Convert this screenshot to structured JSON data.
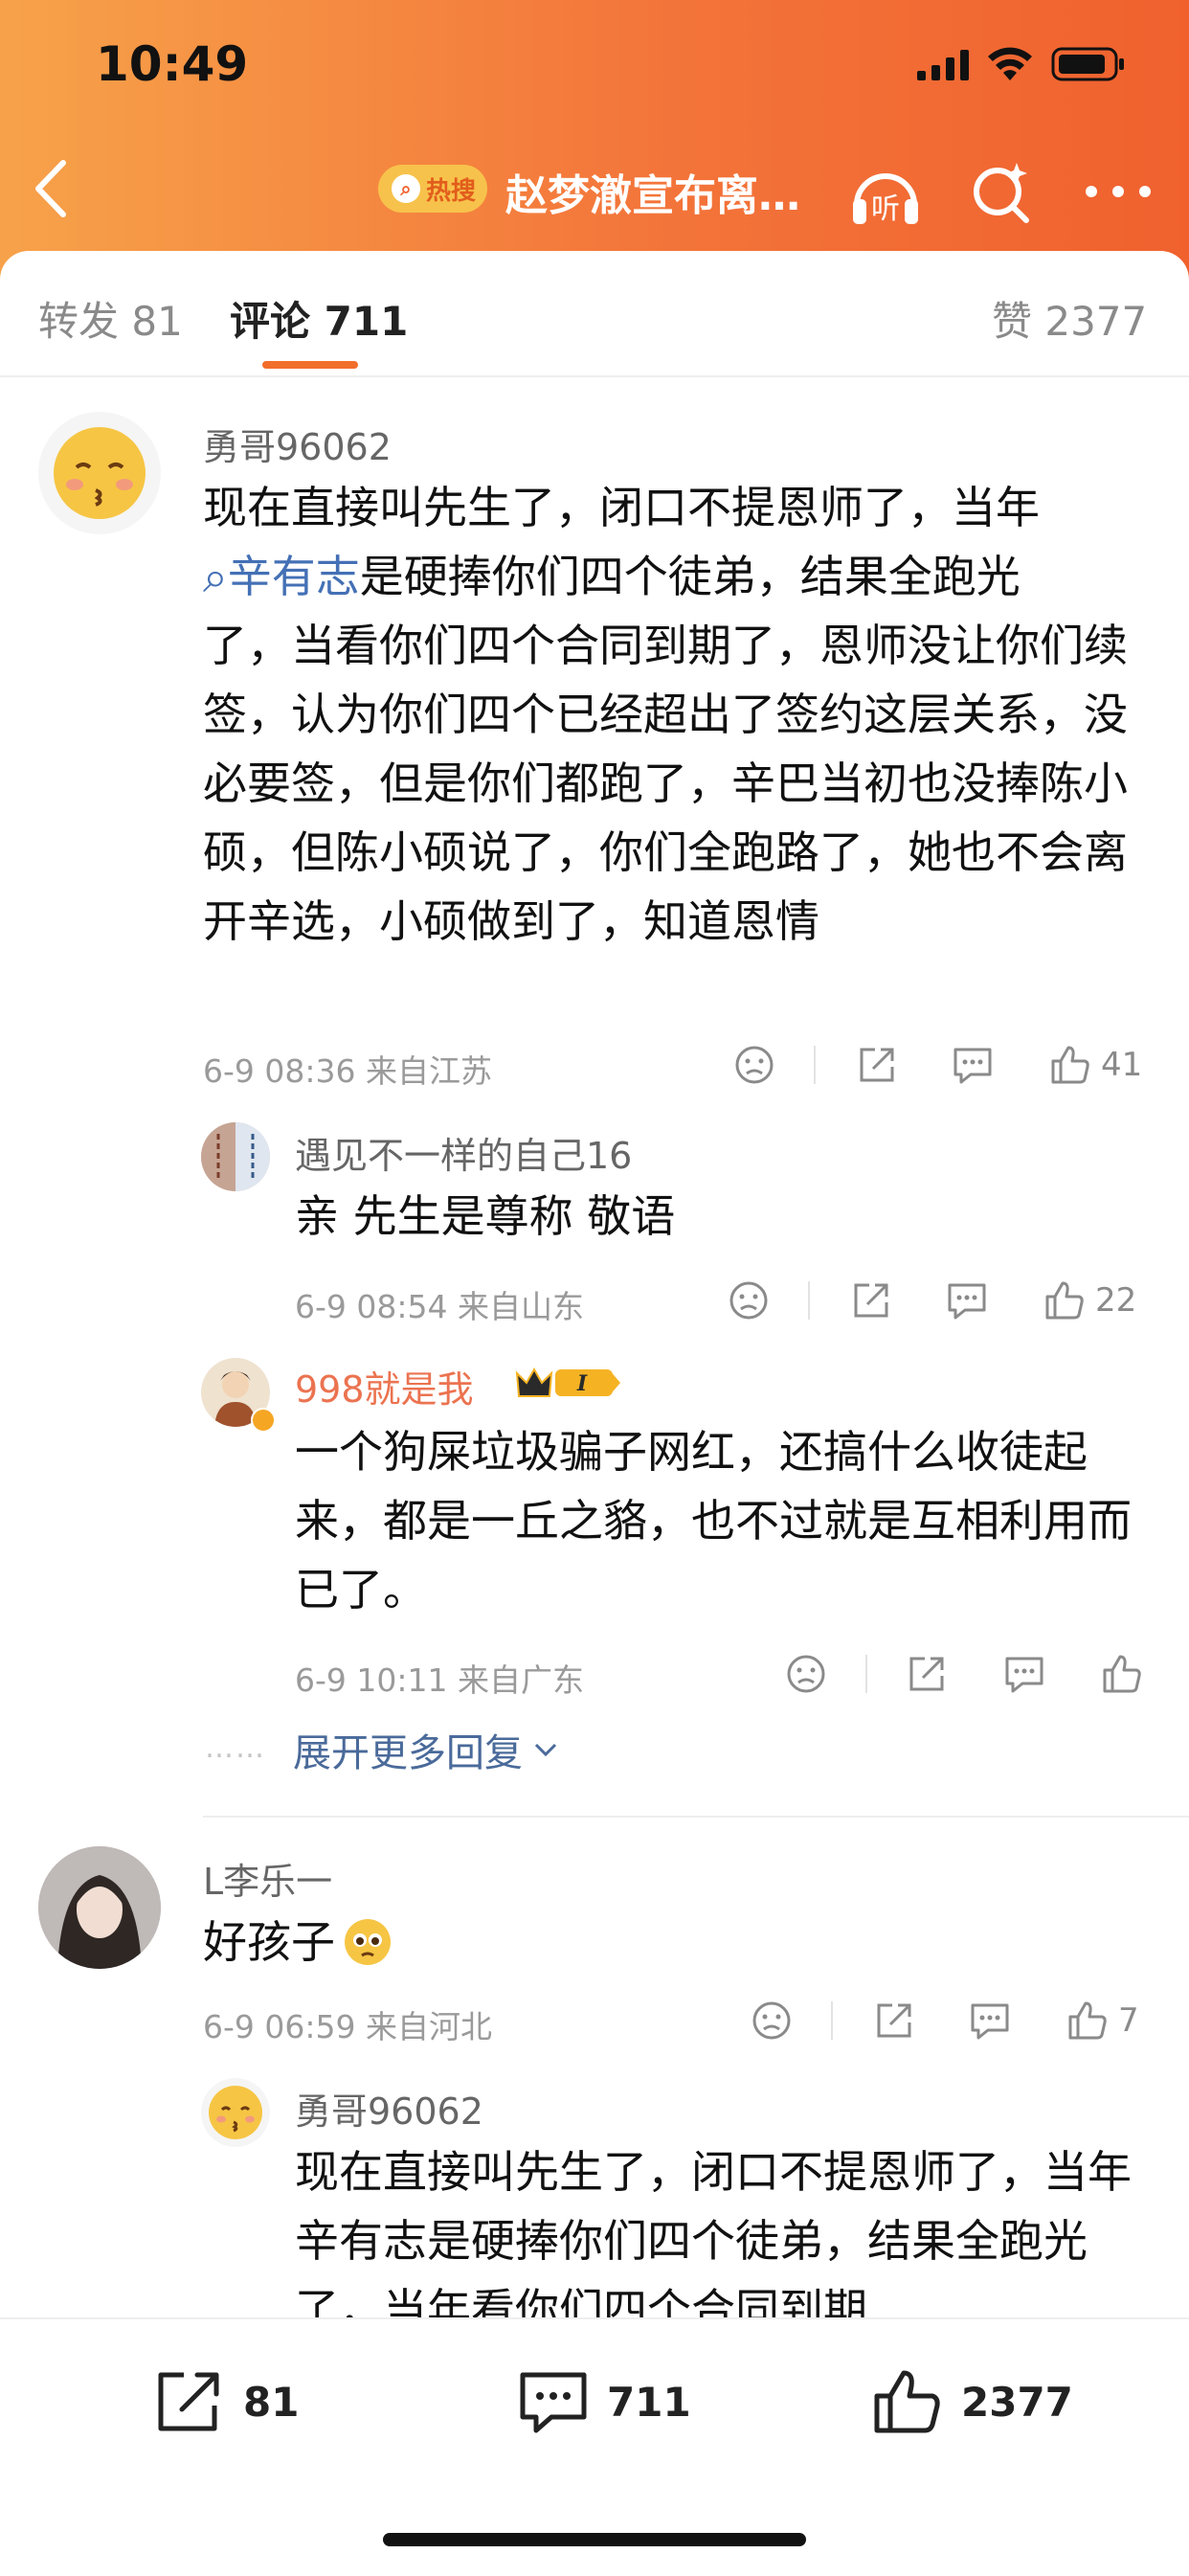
{
  "status": {
    "time": "10:49"
  },
  "nav": {
    "hot_label": "热搜",
    "title": "赵梦澈宣布离…",
    "listen_label": "听"
  },
  "tabs": {
    "repost": "转发 81",
    "comments": "评论 711",
    "likes": "赞 2377"
  },
  "comments": [
    {
      "user": "勇哥96062",
      "mention": "辛有志",
      "line1": "现在直接叫先生了，闭口不提恩师了，当年",
      "line2_rest": "是硬捧你们四个徒弟，结果全跑光",
      "rest": "了，当看你们四个合同到期了，恩师没让你们续签，认为你们四个已经超出了签约这层关系，没必要签，但是你们都跑了，辛巴当初也没捧陈小硕，但陈小硕说了，你们全跑路了，她也不会离开辛选，小硕做到了，知道恩情",
      "time": "6-9 08:36",
      "location": "来自江苏",
      "likes": "41",
      "replies": [
        {
          "user": "遇见不一样的自己16",
          "text": "亲  先生是尊称 敬语",
          "time": "6-9 08:54",
          "location": "来自山东",
          "likes": "22"
        },
        {
          "user": "998就是我",
          "text": "一个狗屎垃圾骗子网红，还搞什么收徒起来，都是一丘之貉，也不过就是互相利用而已了。",
          "time": "6-9 10:11",
          "location": "来自广东",
          "likes": ""
        }
      ],
      "expand_label": "展开更多回复"
    },
    {
      "user": "L李乐一",
      "text": "好孩子",
      "time": "6-9 06:59",
      "location": "来自河北",
      "likes": "7",
      "replies": [
        {
          "user": "勇哥96062",
          "text": "现在直接叫先生了，闭口不提恩师了，当年辛有志是硬捧你们四个徒弟，结果全跑光了，当年看你们四个合同到期"
        }
      ]
    }
  ],
  "bottom": {
    "repost": "81",
    "comments": "711",
    "likes": "2377"
  }
}
